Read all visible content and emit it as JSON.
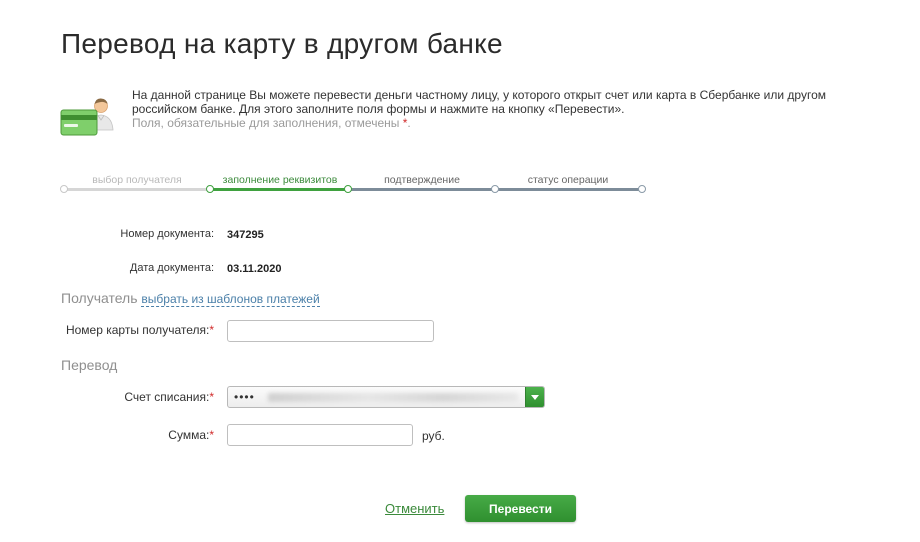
{
  "page": {
    "title": "Перевод на карту в другом банке"
  },
  "intro": {
    "text": "На данной странице Вы можете перевести деньги частному лицу, у которого открыт счет или карта в Сбербанке или другом российском банке. Для этого заполните поля формы и нажмите на кнопку «Перевести».",
    "required_note": "Поля, обязательные для заполнения, отмечены",
    "required_mark": "*",
    "required_end": ".",
    "icon": "card-user-icon"
  },
  "steps": [
    {
      "label": "выбор получателя",
      "state": "done"
    },
    {
      "label": "заполнение реквизитов",
      "state": "active"
    },
    {
      "label": "подтверждение",
      "state": "pending"
    },
    {
      "label": "статус операции",
      "state": "pending"
    }
  ],
  "document": {
    "number_label": "Номер документа:",
    "number_value": "347295",
    "date_label": "Дата документа:",
    "date_value": "03.11.2020"
  },
  "recipient": {
    "section_title": "Получатель",
    "templates_link": "выбрать из шаблонов платежей",
    "card_label": "Номер карты получателя:",
    "card_value": "",
    "required_mark": "*"
  },
  "transfer": {
    "section_title": "Перевод",
    "account_label": "Счет списания:",
    "account_value": "••••",
    "amount_label": "Сумма:",
    "amount_value": "",
    "currency": "руб.",
    "required_mark": "*"
  },
  "actions": {
    "cancel_label": "Отменить",
    "submit_label": "Перевести"
  },
  "colors": {
    "accent_green": "#3fa13f",
    "link_blue": "#4a7fa8",
    "required_red": "#d12b2b"
  }
}
